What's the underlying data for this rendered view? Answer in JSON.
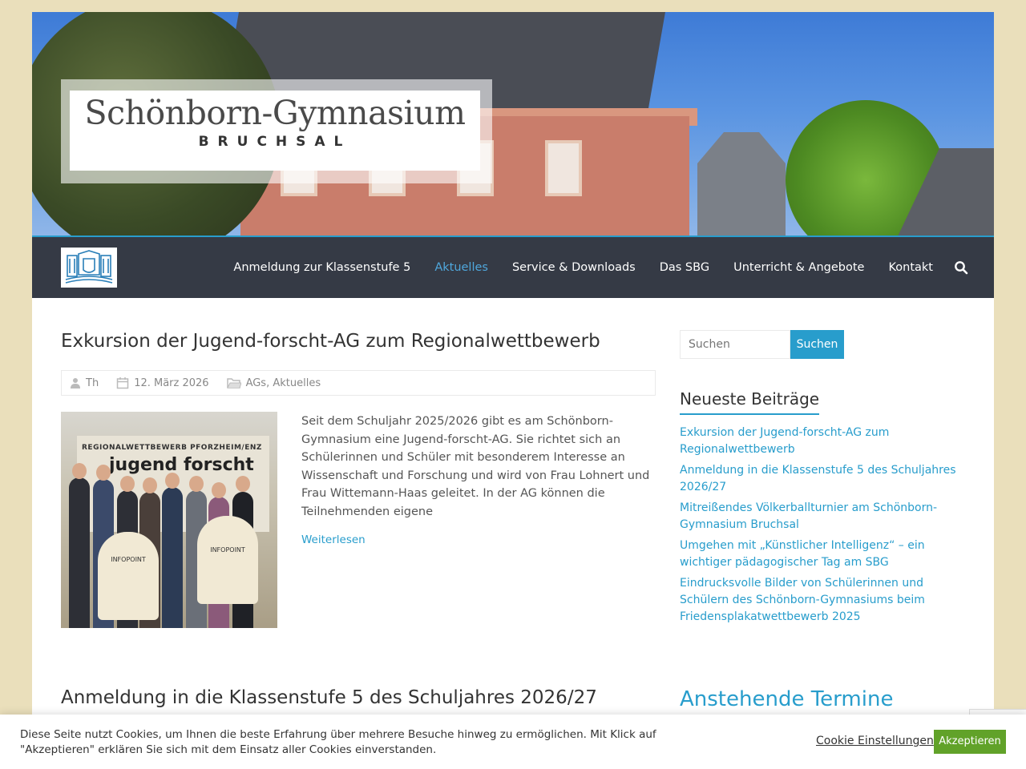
{
  "header": {
    "logo_title": "Schönborn-Gymnasium",
    "logo_subtitle": "BRUCHSAL"
  },
  "nav": {
    "items": [
      {
        "label": "Anmeldung zur Klassenstufe 5",
        "active": false
      },
      {
        "label": "Aktuelles",
        "active": true
      },
      {
        "label": "Service & Downloads",
        "active": false
      },
      {
        "label": "Das SBG",
        "active": false
      },
      {
        "label": "Unterricht & Angebote",
        "active": false
      },
      {
        "label": "Kontakt",
        "active": false
      }
    ],
    "search_icon": "search-icon"
  },
  "posts": [
    {
      "title": "Exkursion der Jugend-forscht-AG zum Regionalwettbewerb",
      "author": "Th",
      "date": "12. März 2026",
      "categories": "AGs, Aktuelles",
      "image_banner_text": "REGIONALWETTBEWERB PFORZHEIM/ENZ",
      "image_banner_brand": "jugend forscht",
      "image_counter_text": "INFOPOINT",
      "excerpt": "Seit dem Schuljahr 2025/2026 gibt es am Schönborn-Gymnasium eine Jugend-forscht-AG. Sie richtet sich an Schülerinnen und Schüler mit besonderem Interesse an Wissenschaft und Forschung und wird von Frau Lohnert und Frau Wittemann-Haas geleitet. In der AG können die Teilnehmenden eigene",
      "read_more": "Weiterlesen"
    },
    {
      "title": "Anmeldung in die Klassenstufe 5 des Schuljahres 2026/27"
    }
  ],
  "sidebar": {
    "search_placeholder": "Suchen",
    "search_button": "Suchen",
    "recent_title": "Neueste Beiträge",
    "recent_posts": [
      "Exkursion der Jugend-forscht-AG zum Regionalwettbewerb",
      "Anmeldung in die Klassenstufe 5 des Schuljahres 2026/27",
      "Mitreißendes Völkerballturnier am Schönborn-Gymnasium Bruchsal",
      "Umgehen mit „Künstlicher Intelligenz“ – ein wichtiger pädagogischer Tag am SBG",
      "Eindrucksvolle Bilder von Schülerinnen und Schülern des Schönborn-Gymnasiums beim Friedensplakatwettbewerb 2025"
    ],
    "upcoming_title": "Anstehende Termine"
  },
  "cookie": {
    "text": "Diese Seite nutzt Cookies, um Ihnen die beste Erfahrung über mehrere Besuche hinweg zu ermöglichen. Mit Klick auf \"Akzeptieren\" erklären Sie sich mit dem Einsatz aller Cookies einverstanden.",
    "settings_label": "Cookie Einstellungen",
    "accept_label": "Akzeptieren"
  },
  "colors": {
    "accent": "#289dcc",
    "nav_bg": "#353a45",
    "page_bg": "#eadfbb",
    "accept_green": "#61a229"
  }
}
